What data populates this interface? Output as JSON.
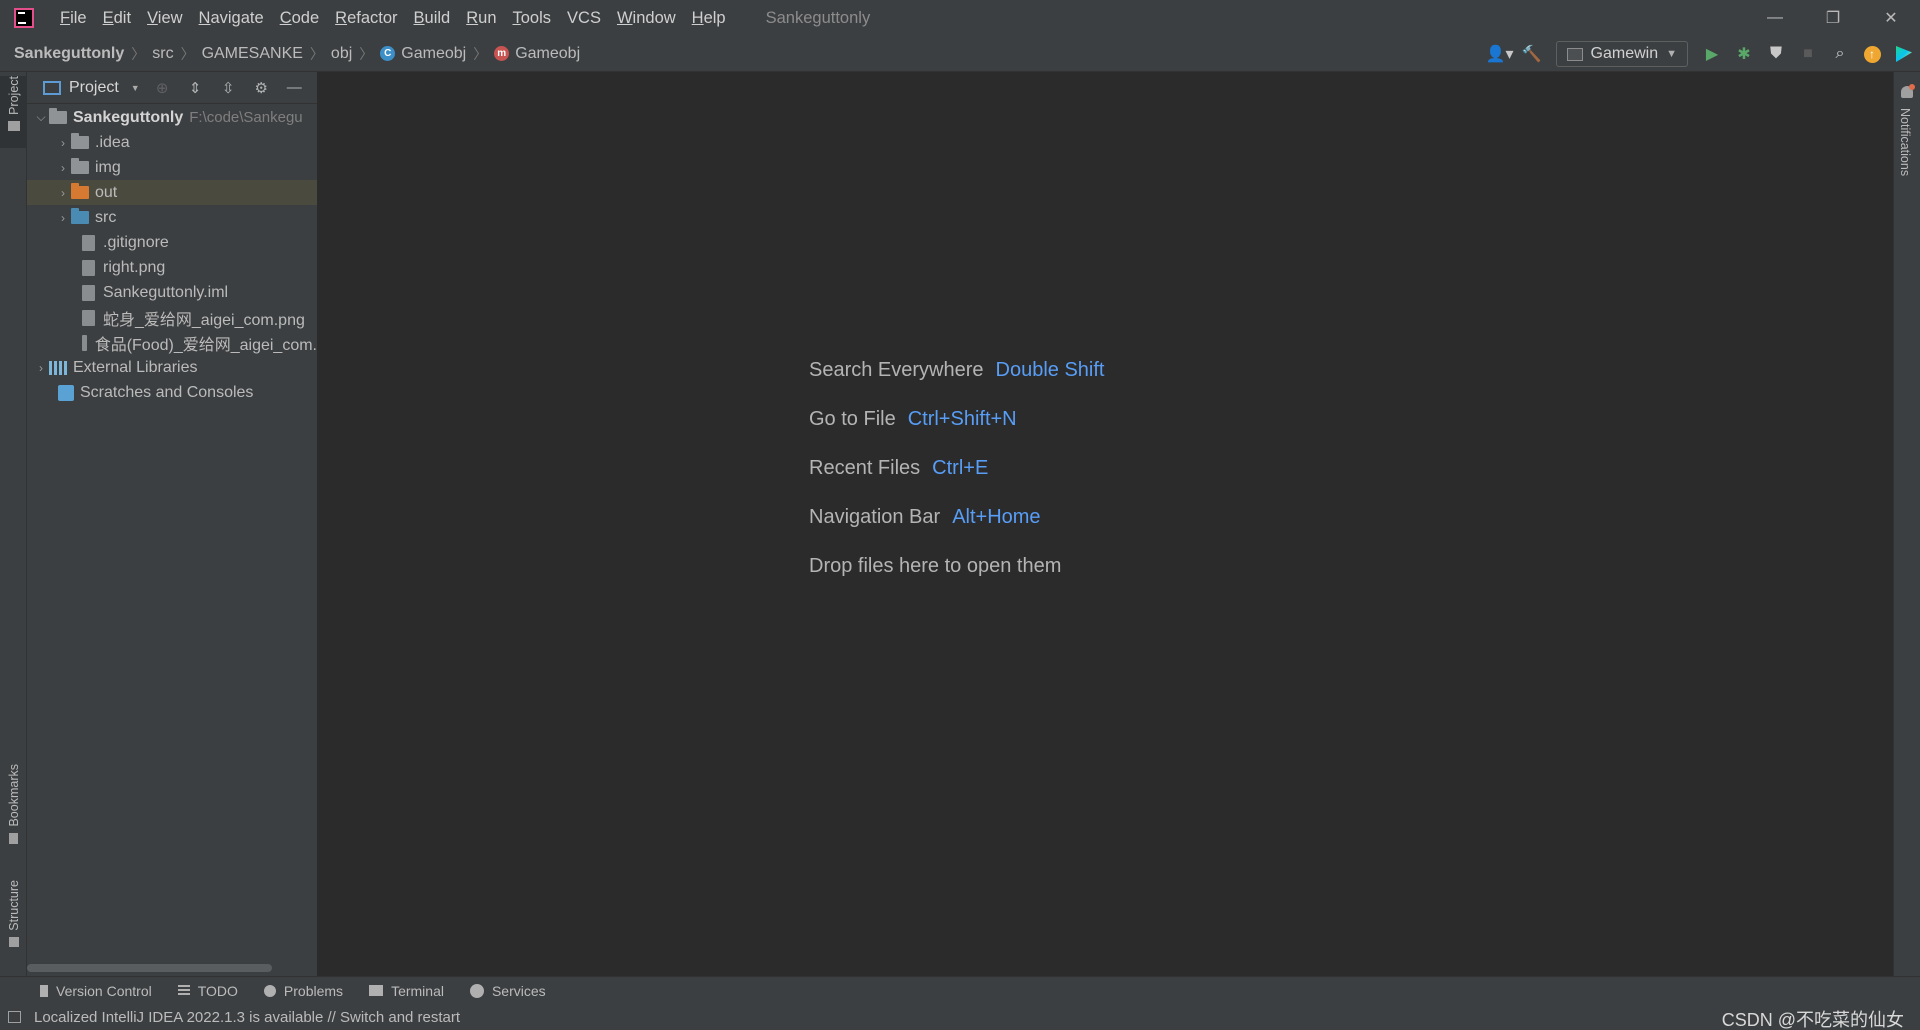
{
  "titlebar": {
    "menu": [
      {
        "m": "F",
        "rest": "ile"
      },
      {
        "m": "E",
        "rest": "dit"
      },
      {
        "m": "V",
        "rest": "iew"
      },
      {
        "m": "N",
        "rest": "avigate"
      },
      {
        "m": "C",
        "rest": "ode"
      },
      {
        "m": "R",
        "rest": "efactor"
      },
      {
        "m": "B",
        "rest": "uild"
      },
      {
        "m": "R",
        "rest": "un"
      },
      {
        "m": "T",
        "rest": "ools"
      },
      {
        "m": "",
        "rest": "VCS"
      },
      {
        "m": "W",
        "rest": "indow"
      },
      {
        "m": "H",
        "rest": "elp"
      }
    ],
    "window_title": "Sankeguttonly",
    "controls": {
      "minimize": "—",
      "restore": "❐",
      "close": "✕"
    }
  },
  "navbar": {
    "breadcrumbs": [
      "Sankeguttonly",
      "src",
      "GAMESANKE",
      "obj",
      "Gameobj",
      "Gameobj"
    ],
    "class_badge": "C",
    "method_badge": "m",
    "run_config": "Gamewin"
  },
  "left_stripe": {
    "project": "Project",
    "bookmarks": "Bookmarks",
    "structure": "Structure"
  },
  "project_panel": {
    "title": "Project",
    "root_name": "Sankeguttonly",
    "root_path": "F:\\code\\Sankegu",
    "items": [
      {
        "label": ".idea",
        "type": "folder-gray"
      },
      {
        "label": "img",
        "type": "folder-gray"
      },
      {
        "label": "out",
        "type": "folder-orange"
      },
      {
        "label": "src",
        "type": "folder-blue"
      },
      {
        "label": ".gitignore",
        "type": "file"
      },
      {
        "label": "right.png",
        "type": "file"
      },
      {
        "label": "Sankeguttonly.iml",
        "type": "file"
      },
      {
        "label": "蛇身_爱给网_aigei_com.png",
        "type": "file"
      },
      {
        "label": "食品(Food)_爱给网_aigei_com.",
        "type": "file"
      }
    ],
    "external_libraries": "External Libraries",
    "scratches": "Scratches and Consoles"
  },
  "editor": {
    "hints": [
      {
        "label": "Search Everywhere",
        "key": "Double Shift"
      },
      {
        "label": "Go to File",
        "key": "Ctrl+Shift+N"
      },
      {
        "label": "Recent Files",
        "key": "Ctrl+E"
      },
      {
        "label": "Navigation Bar",
        "key": "Alt+Home"
      }
    ],
    "drop_text": "Drop files here to open them"
  },
  "right_stripe": {
    "notifications": "Notifications"
  },
  "tool_tabs": [
    "Version Control",
    "TODO",
    "Problems",
    "Terminal",
    "Services"
  ],
  "status": {
    "message": "Localized IntelliJ IDEA 2022.1.3 is available // Switch and restart",
    "watermark": "CSDN @不吃菜的仙女"
  },
  "colors": {
    "accent_key": "#589df6",
    "run_green": "#59a869",
    "selection": "#4b4a3f"
  }
}
